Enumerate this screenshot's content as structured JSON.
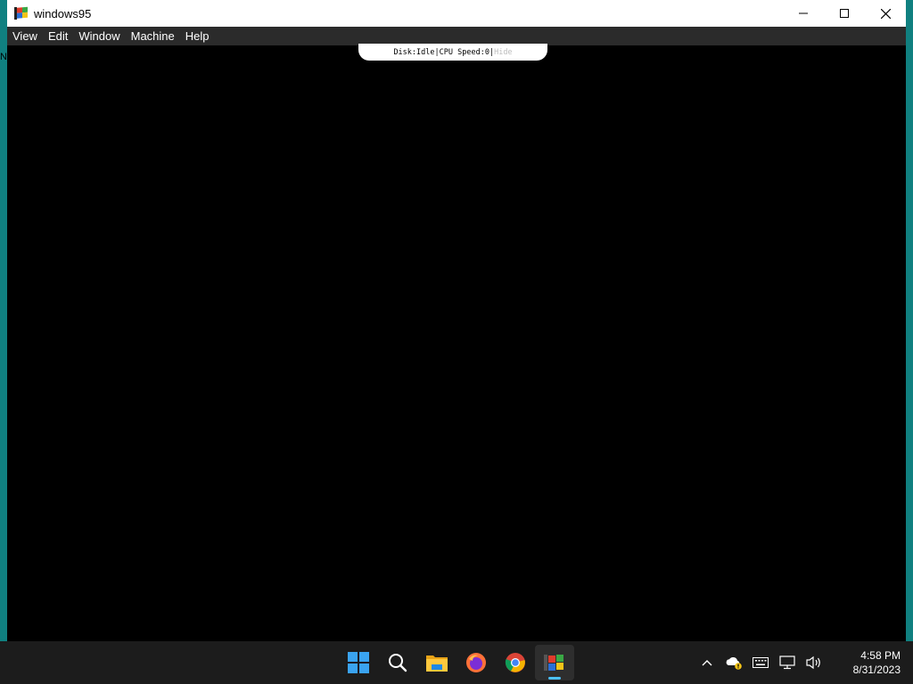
{
  "window": {
    "title": "windows95",
    "icon": "windows95-app-icon",
    "controls": {
      "minimize": "minimize-icon",
      "maximize": "maximize-icon",
      "close": "close-icon"
    }
  },
  "menubar": {
    "items": [
      "View",
      "Edit",
      "Window",
      "Machine",
      "Help"
    ]
  },
  "status": {
    "disk_label": "Disk:",
    "disk_value": "Idle",
    "separator": "|",
    "cpu_label": "CPU Speed:",
    "cpu_value": "0",
    "hide_label": "Hide"
  },
  "edge_glyph": "N",
  "taskbar": {
    "apps": [
      {
        "name": "start-icon"
      },
      {
        "name": "search-icon"
      },
      {
        "name": "file-explorer-icon"
      },
      {
        "name": "firefox-icon"
      },
      {
        "name": "chrome-icon"
      },
      {
        "name": "windows95-app-icon",
        "active": true
      }
    ],
    "tray": {
      "icons": [
        "chevron-up-icon",
        "onedrive-warning-icon",
        "keyboard-icon",
        "network-icon",
        "volume-icon"
      ]
    },
    "clock": {
      "time": "4:58 PM",
      "date": "8/31/2023"
    }
  },
  "colors": {
    "desktop": "#108080",
    "titlebar": "#ffffff",
    "menubar": "#2b2b2b",
    "screen": "#000000",
    "taskbar": "#1c1c1c",
    "accent": "#4cc2ff"
  }
}
